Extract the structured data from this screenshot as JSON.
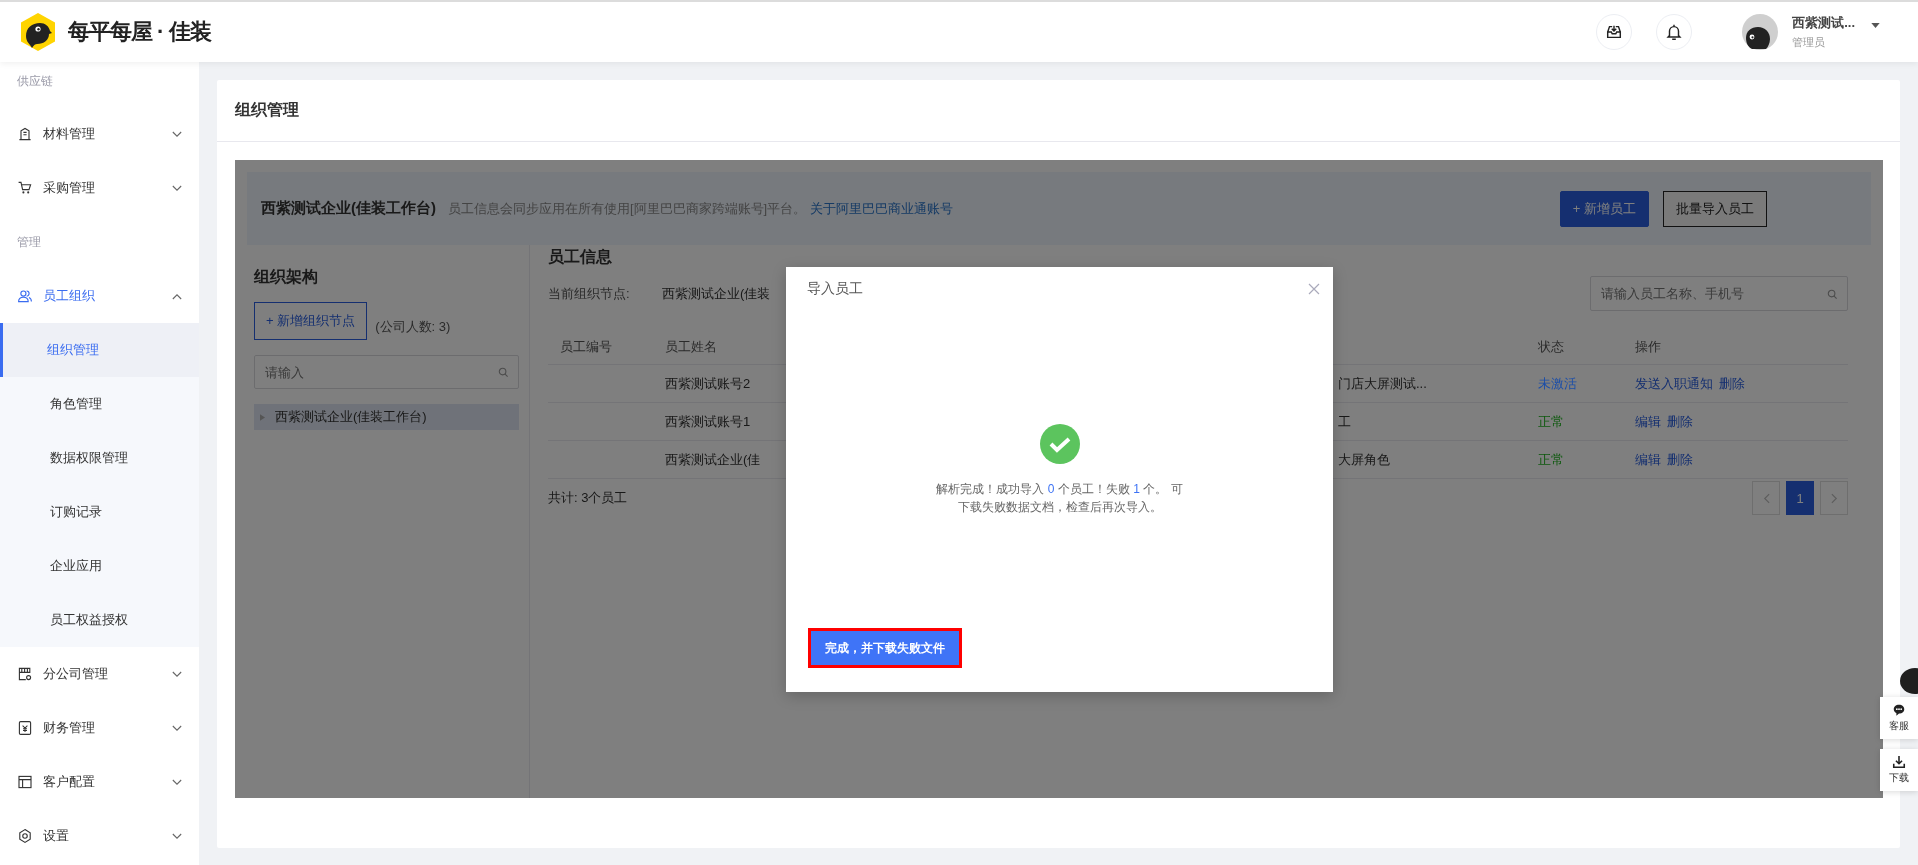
{
  "header": {
    "logo_text": "每平每屋 · 佳装",
    "user": {
      "name": "西紫测试...",
      "role": "管理员"
    }
  },
  "sidebar": {
    "groups": [
      {
        "label": "供应链",
        "items": [
          {
            "label": "材料管理",
            "expanded": false
          },
          {
            "label": "采购管理",
            "expanded": false
          }
        ]
      },
      {
        "label": "管理",
        "items": [
          {
            "label": "员工组织",
            "expanded": true,
            "children": [
              {
                "label": "组织管理",
                "selected": true
              },
              {
                "label": "角色管理",
                "selected": false
              },
              {
                "label": "数据权限管理",
                "selected": false
              },
              {
                "label": "订购记录",
                "selected": false
              },
              {
                "label": "企业应用",
                "selected": false
              },
              {
                "label": "员工权益授权",
                "selected": false
              }
            ]
          },
          {
            "label": "分公司管理",
            "expanded": false
          },
          {
            "label": "财务管理",
            "expanded": false
          },
          {
            "label": "客户配置",
            "expanded": false
          },
          {
            "label": "设置",
            "expanded": false
          }
        ]
      }
    ]
  },
  "page": {
    "title": "组织管理",
    "banner": {
      "company": "西紫测试企业(佳装工作台)",
      "description": "员工信息会同步应用在所有使用[阿里巴巴商家跨端账号]平台。",
      "link": "关于阿里巴巴商业通账号",
      "buttons": [
        {
          "label": "+ 新增员工",
          "kind": "primary"
        },
        {
          "label": "批量导入员工",
          "kind": "default"
        }
      ]
    },
    "org_tree": {
      "title": "组织架构",
      "add_button": "+ 新增组织节点",
      "count": "(公司人数: 3)",
      "search_placeholder": "请输入",
      "nodes": [
        {
          "label": "西紫测试企业(佳装工作台)",
          "selected": true
        }
      ]
    },
    "employees": {
      "title": "员工信息",
      "current_node_label": "当前组织节点:",
      "current_node": "西紫测试企业(佳装",
      "search_placeholder": "请输入员工名称、手机号",
      "columns": [
        "员工编号",
        "员工姓名",
        "状态",
        "操作"
      ],
      "rows": [
        {
          "name": "西紫测试账号2",
          "column_3": "门店大屏测试...",
          "status": "未激活",
          "color": "#1d4fa8",
          "actions": [
            "发送入职通知",
            "删除"
          ]
        },
        {
          "name": "西紫测试账号1",
          "column_3": "工",
          "status": "正常",
          "color": "#0f5a0f",
          "actions": [
            "编辑",
            "删除"
          ]
        },
        {
          "name": "西紫测试企业(佳",
          "column_3": "大屏角色",
          "status": "正常",
          "color": "#0f5a0f",
          "actions": [
            "编辑",
            "删除"
          ]
        }
      ],
      "total": "共计: 3个员工",
      "pages": [
        {
          "label": "1",
          "selected": true
        }
      ]
    }
  },
  "modal": {
    "title": "导入员工",
    "message": [
      {
        "text": "解析完成！成功导入 ",
        "kind": "text"
      },
      {
        "text": "0",
        "kind": "number"
      },
      {
        "text": " 个员工！失败 ",
        "kind": "text"
      },
      {
        "text": "1",
        "kind": "number"
      },
      {
        "text": " 个。 可下载失败数据文档，检查后再次导入。",
        "kind": "text"
      }
    ],
    "button": "完成，并下载失败文件"
  },
  "floating_tools": [
    {
      "label": "客服"
    },
    {
      "label": "下载"
    }
  ]
}
